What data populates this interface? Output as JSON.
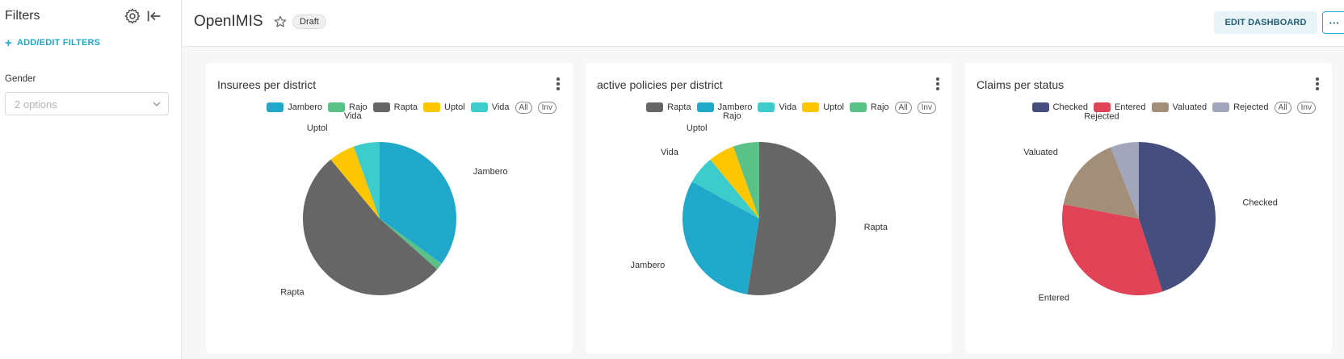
{
  "sidebar": {
    "title": "Filters",
    "add_filters_label": "ADD/EDIT FILTERS",
    "filter": {
      "label": "Gender",
      "placeholder": "2 options"
    }
  },
  "header": {
    "title": "OpenIMIS",
    "status_badge": "Draft",
    "edit_button": "EDIT DASHBOARD",
    "more_button": "···"
  },
  "legend_controls": {
    "all": "All",
    "inv": "Inv"
  },
  "charts": [
    {
      "title": "Insurees per district",
      "legend": [
        {
          "name": "Jambero",
          "color": "#1fa8c9"
        },
        {
          "name": "Rajo",
          "color": "#5ac189"
        },
        {
          "name": "Rapta",
          "color": "#666666"
        },
        {
          "name": "Uptol",
          "color": "#fcc700"
        },
        {
          "name": "Vida",
          "color": "#3ccccb"
        }
      ]
    },
    {
      "title": "active policies per district",
      "legend": [
        {
          "name": "Rapta",
          "color": "#666666"
        },
        {
          "name": "Jambero",
          "color": "#1fa8c9"
        },
        {
          "name": "Vida",
          "color": "#3ccccb"
        },
        {
          "name": "Uptol",
          "color": "#fcc700"
        },
        {
          "name": "Rajo",
          "color": "#5ac189"
        }
      ]
    },
    {
      "title": "Claims per status",
      "legend": [
        {
          "name": "Checked",
          "color": "#454e7c"
        },
        {
          "name": "Entered",
          "color": "#e04355"
        },
        {
          "name": "Valuated",
          "color": "#a38f79"
        },
        {
          "name": "Rejected",
          "color": "#a1a6bd"
        }
      ]
    }
  ],
  "chart_data": [
    {
      "type": "pie",
      "title": "Insurees per district",
      "categories": [
        "Jambero",
        "Rajo",
        "Rapta",
        "Uptol",
        "Vida"
      ],
      "values": [
        35,
        1.5,
        52.5,
        5.5,
        5.5
      ],
      "labels_shown": [
        "Jambero",
        "Rapta",
        "Uptol",
        "Vida"
      ],
      "colors": [
        "#1fa8c9",
        "#5ac189",
        "#666666",
        "#fcc700",
        "#3ccccb"
      ]
    },
    {
      "type": "pie",
      "title": "active policies per district",
      "categories": [
        "Rapta",
        "Jambero",
        "Vida",
        "Uptol",
        "Rajo"
      ],
      "values": [
        52.5,
        30.5,
        6,
        5.5,
        5.5
      ],
      "labels_shown": [
        "Rapta",
        "Jambero",
        "Vida",
        "Uptol",
        "Rajo"
      ],
      "colors": [
        "#666666",
        "#1fa8c9",
        "#3ccccb",
        "#fcc700",
        "#5ac189"
      ]
    },
    {
      "type": "pie",
      "title": "Claims per status",
      "categories": [
        "Checked",
        "Entered",
        "Valuated",
        "Rejected"
      ],
      "values": [
        45,
        33,
        16,
        6
      ],
      "labels_shown": [
        "Checked",
        "Entered",
        "Valuated",
        "Rejected"
      ],
      "colors": [
        "#454e7c",
        "#e04355",
        "#a38f79",
        "#a1a6bd"
      ]
    }
  ]
}
